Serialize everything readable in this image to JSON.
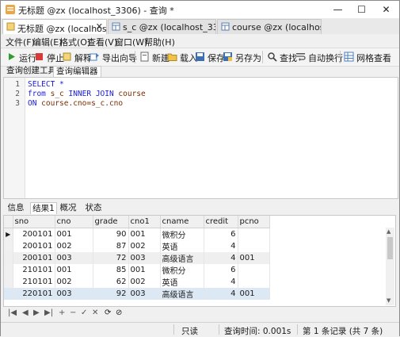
{
  "window": {
    "title": "无标题 @zx (localhost_3306) - 查询 *",
    "controls": [
      "—",
      "☐",
      "✕"
    ]
  },
  "doc_tabs": [
    {
      "label": "无标题 @zx (localhost_3306)",
      "close": "✕"
    },
    {
      "label": "s_c @zx (localhost_3306..."
    },
    {
      "label": "course @zx (localhost_3..."
    }
  ],
  "menu": [
    "文件(F)",
    "编辑(E)",
    "格式(O)",
    "查看(V)",
    "窗口(W)",
    "帮助(H)"
  ],
  "toolbar": {
    "run": "运行",
    "stop": "停止",
    "explain": "解释",
    "export": "导出向导",
    "new": "新建",
    "load": "载入",
    "save": "保存",
    "save_as": "另存为",
    "find": "查找",
    "auto_wrap": "自动换行",
    "grid_view": "网格查看"
  },
  "sub_tabs": [
    "查询创建工具",
    "查询编辑器"
  ],
  "editor": {
    "line_numbers": [
      "1",
      "2",
      "3"
    ],
    "line1_kw": "SELECT *",
    "line2_a": "from ",
    "line2_b": "s_c",
    "line2_c": " INNER JOIN ",
    "line2_d": "course",
    "line3_a": "ON ",
    "line3_b": "course.cno=s_c.cno"
  },
  "result_tabs": [
    "信息",
    "结果1",
    "概况",
    "状态"
  ],
  "table": {
    "columns": [
      "sno",
      "cno",
      "grade",
      "cno1",
      "cname",
      "credit",
      "pcno"
    ],
    "rows": [
      [
        "200101",
        "001",
        "90",
        "001",
        "微积分",
        "6",
        ""
      ],
      [
        "200101",
        "002",
        "87",
        "002",
        "英语",
        "4",
        ""
      ],
      [
        "200101",
        "003",
        "72",
        "003",
        "高级语言",
        "4",
        "001"
      ],
      [
        "210101",
        "001",
        "85",
        "001",
        "微积分",
        "6",
        ""
      ],
      [
        "210101",
        "002",
        "62",
        "002",
        "英语",
        "4",
        ""
      ],
      [
        "220101",
        "003",
        "92",
        "003",
        "高级语言",
        "4",
        "001"
      ]
    ],
    "current_row_marker": "▶"
  },
  "nav_buttons": [
    "|◀",
    "◀",
    "▶",
    "▶|",
    "+",
    "−",
    "✓",
    "✕",
    "⟳",
    "⊘"
  ],
  "status": {
    "mode": "只读",
    "query_time": "查询时间: 0.001s",
    "record": "第 1 条记录 (共 7 条)"
  },
  "colors": {
    "keyword": "#1a1ad8",
    "identifier": "#7a2c00",
    "selected_row": "#dde8f5"
  }
}
